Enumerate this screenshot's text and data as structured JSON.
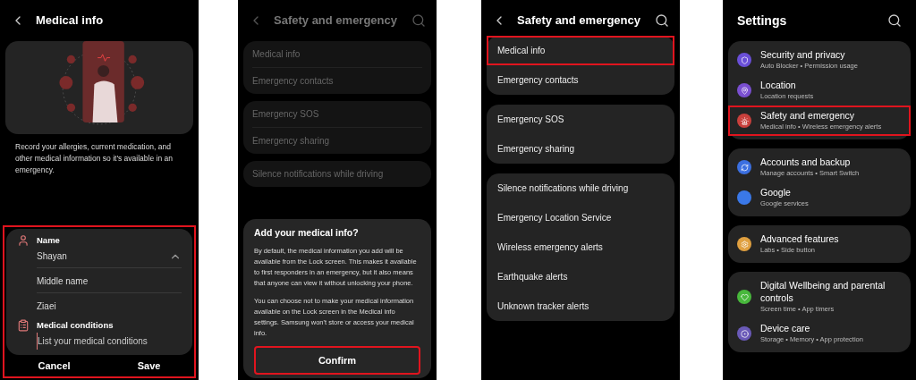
{
  "medical_info_screen": {
    "title": "Medical info",
    "description": "Record your allergies, current medication, and other medical information so it's available in an emergency.",
    "form": {
      "highlighted": true,
      "sections": [
        {
          "kind": "name",
          "label": "Name",
          "expanded": true,
          "values": [
            "Shayan",
            "Middle name",
            "Ziaei"
          ]
        },
        {
          "kind": "conditions",
          "label": "Medical conditions",
          "placeholder": "List your medical conditions"
        }
      ]
    },
    "buttons": [
      "Cancel",
      "Save"
    ]
  },
  "consent_dialog_screen": {
    "title": "Safety and emergency",
    "groups": [
      [
        "Medical info",
        "Emergency contacts"
      ],
      [
        "Emergency SOS",
        "Emergency sharing"
      ],
      [
        "Silence notifications while driving"
      ]
    ],
    "dialog": {
      "title": "Add your medical info?",
      "paragraphs": [
        "By default, the medical information you add will be available from the Lock screen. This makes it available to first responders in an emergency, but it also means that anyone can view it without unlocking your phone.",
        "You can choose not to make your medical information available on the Lock screen in the Medical info settings. Samsung won't store or access your medical info."
      ],
      "button": {
        "label": "Confirm",
        "highlighted": true
      }
    }
  },
  "safety_screen": {
    "title": "Safety and emergency",
    "groups": [
      [
        {
          "label": "Medical info",
          "highlighted": true
        },
        {
          "label": "Emergency contacts",
          "highlighted": false
        }
      ],
      [
        {
          "label": "Emergency SOS",
          "highlighted": false
        },
        {
          "label": "Emergency sharing",
          "highlighted": false
        }
      ],
      [
        {
          "label": "Silence notifications while driving",
          "highlighted": false
        },
        {
          "label": "Emergency Location Service",
          "highlighted": false
        },
        {
          "label": "Wireless emergency alerts",
          "highlighted": false
        },
        {
          "label": "Earthquake alerts",
          "highlighted": false
        },
        {
          "label": "Unknown tracker alerts",
          "highlighted": false
        }
      ]
    ]
  },
  "settings_screen": {
    "title": "Settings",
    "groups": [
      [
        {
          "kind": "shield",
          "title": "Security and privacy",
          "subtitle": "Auto Blocker • Permission usage",
          "color": "#6a4fd8",
          "highlighted": false
        },
        {
          "kind": "pin",
          "title": "Location",
          "subtitle": "Location requests",
          "color": "#7a4fd0",
          "highlighted": false
        },
        {
          "kind": "alert",
          "title": "Safety and emergency",
          "subtitle": "Medical info • Wireless emergency alerts",
          "color": "#c8403c",
          "highlighted": true
        }
      ],
      [
        {
          "kind": "sync",
          "title": "Accounts and backup",
          "subtitle": "Manage accounts • Smart Switch",
          "color": "#3b6fe0",
          "highlighted": false
        },
        {
          "kind": "g",
          "title": "Google",
          "subtitle": "Google services",
          "color": "#3a78e8",
          "highlighted": false
        }
      ],
      [
        {
          "kind": "gear",
          "title": "Advanced features",
          "subtitle": "Labs • Side button",
          "color": "#e0a040",
          "highlighted": false
        }
      ],
      [
        {
          "kind": "heart",
          "title": "Digital Wellbeing and parental controls",
          "subtitle": "Screen time • App timers",
          "color": "#48b83c",
          "highlighted": false
        },
        {
          "kind": "care",
          "title": "Device care",
          "subtitle": "Storage • Memory • App protection",
          "color": "#6a5ab8",
          "highlighted": false
        }
      ]
    ]
  }
}
